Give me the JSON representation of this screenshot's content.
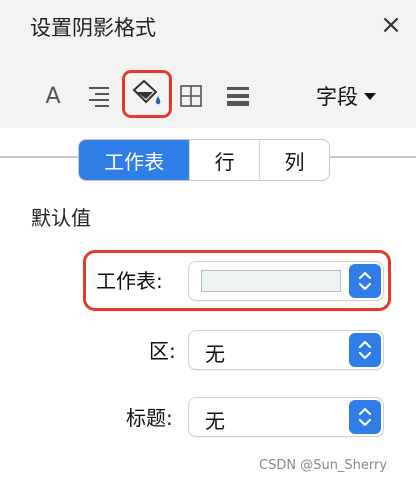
{
  "panel": {
    "title": "设置阴影格式",
    "close": "×"
  },
  "toolbar": {
    "font_icon_glyph": "A",
    "field_menu_label": "字段",
    "icons": [
      "font-icon",
      "align-icon",
      "fill-bucket-icon",
      "border-grid-icon",
      "line-weight-icon"
    ]
  },
  "scope_tabs": [
    "工作表",
    "行",
    "列"
  ],
  "section_title": "默认值",
  "rows": {
    "sheet": {
      "label": "工作表:",
      "value": "",
      "swatch_color": "#eef4f4"
    },
    "area": {
      "label": "区:",
      "value": "无"
    },
    "header": {
      "label": "标题:",
      "value": "无"
    }
  },
  "watermark": "CSDN @Sun_Sherry",
  "colors": {
    "accent": "#2f7de6",
    "highlight": "#e5392d"
  }
}
